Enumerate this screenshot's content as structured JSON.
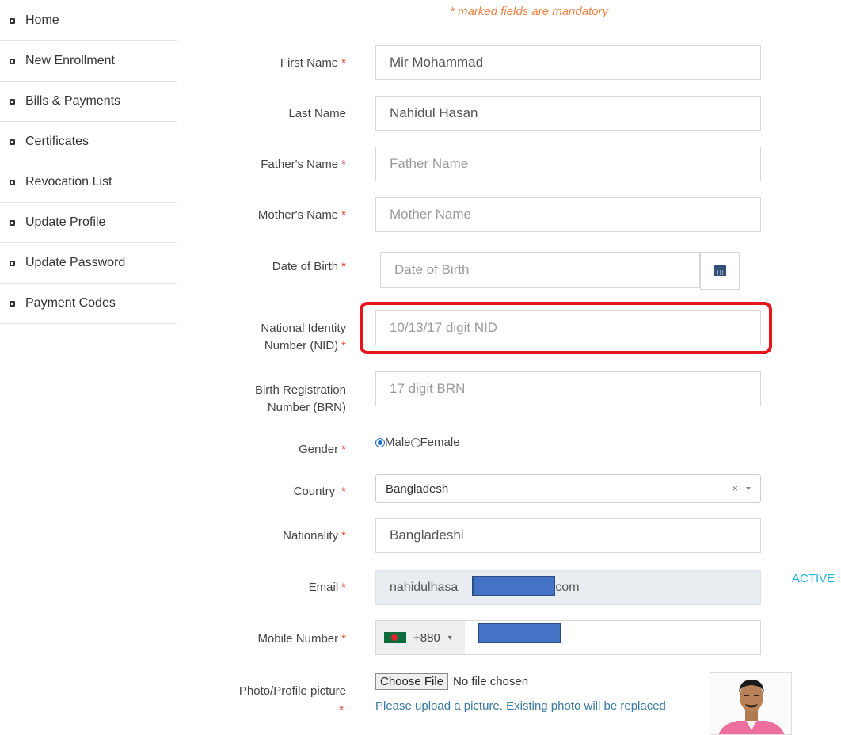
{
  "sidebar": {
    "items": [
      {
        "label": "Home"
      },
      {
        "label": "New Enrollment"
      },
      {
        "label": "Bills & Payments"
      },
      {
        "label": "Certificates"
      },
      {
        "label": "Revocation List"
      },
      {
        "label": "Update Profile"
      },
      {
        "label": "Update Password"
      },
      {
        "label": "Payment Codes"
      }
    ]
  },
  "form": {
    "mandatory_note": "* marked fields are mandatory",
    "required_marker": "*",
    "first_name": {
      "label": "First Name",
      "value": "Mir Mohammad"
    },
    "last_name": {
      "label": "Last Name",
      "value": "Nahidul Hasan"
    },
    "father_name": {
      "label": "Father's Name",
      "placeholder": "Father Name"
    },
    "mother_name": {
      "label": "Mother's Name",
      "placeholder": "Mother Name"
    },
    "dob": {
      "label": "Date of Birth",
      "placeholder": "Date of Birth"
    },
    "nid": {
      "label_line1": "National Identity",
      "label_line2": "Number (NID)",
      "placeholder": "10/13/17 digit NID"
    },
    "brn": {
      "label_line1": "Birth Registration",
      "label_line2": "Number (BRN)",
      "placeholder": "17 digit BRN"
    },
    "gender": {
      "label": "Gender",
      "options": [
        "Male",
        "Female"
      ],
      "selected": "Male"
    },
    "country": {
      "label": "Country",
      "value": "Bangladesh",
      "clear": "×"
    },
    "nationality": {
      "label": "Nationality",
      "value": "Bangladeshi"
    },
    "email": {
      "label": "Email",
      "value_start": "nahidulhasa",
      "value_end": "com",
      "status": "ACTIVE"
    },
    "mobile": {
      "label": "Mobile Number",
      "dial_code": "+880",
      "caret": "▾"
    },
    "photo": {
      "label": "Photo/Profile picture",
      "button": "Choose File",
      "file_status": "No file chosen",
      "help": "Please upload a picture. Existing photo will be replaced"
    }
  },
  "colors": {
    "highlight": "#e8141b",
    "accent": "#1f6fd1",
    "active": "#1fb1d8",
    "mandatory_note": "#f0854a"
  }
}
